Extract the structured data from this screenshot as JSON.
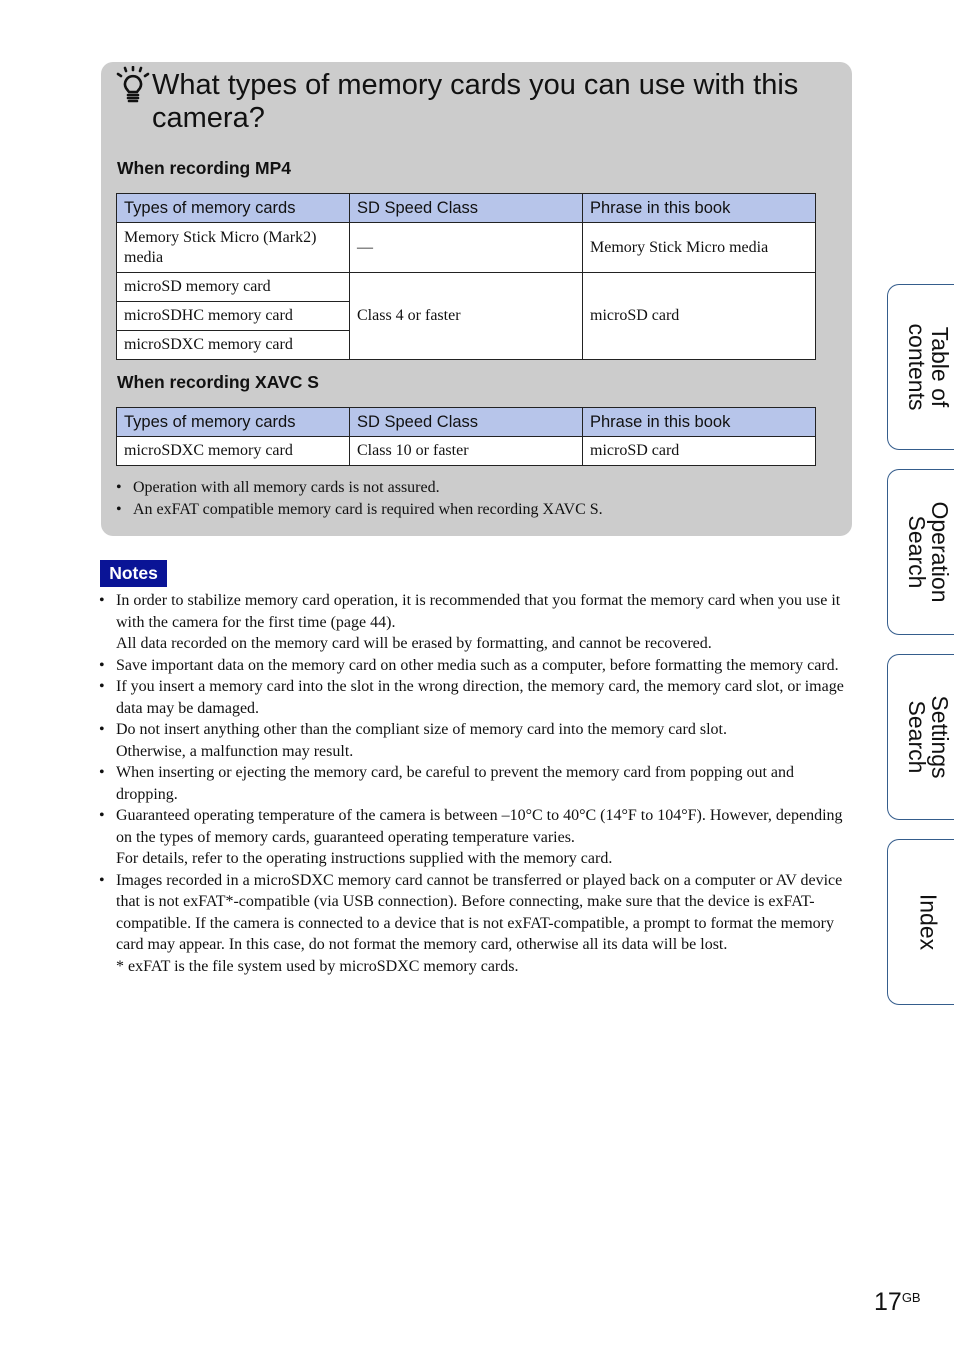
{
  "page": {
    "title": "What types of memory cards you can use with this camera?",
    "title_icon": "hint-lightbulb-icon"
  },
  "mp4_section": {
    "heading": "When recording MP4",
    "columns": [
      "Types of memory cards",
      "SD Speed Class",
      "Phrase in this book"
    ],
    "rows": [
      {
        "type": "Memory Stick Micro (Mark2) media",
        "speed": "—",
        "phrase": "Memory Stick Micro media"
      },
      {
        "type": "microSD memory card",
        "speed": "Class 4 or faster",
        "phrase": "microSD card"
      },
      {
        "type": "microSDHC memory card"
      },
      {
        "type": "microSDXC memory card"
      }
    ]
  },
  "xavc_section": {
    "heading": "When recording XAVC S",
    "columns": [
      "Types of memory cards",
      "SD Speed Class",
      "Phrase in this book"
    ],
    "rows": [
      {
        "type": "microSDXC memory card",
        "speed": "Class 10 or faster",
        "phrase": "microSD card"
      }
    ]
  },
  "panel_bullets": [
    "Operation with all memory cards is not assured.",
    "An exFAT compatible memory card is required when recording XAVC S."
  ],
  "notes": {
    "badge": "Notes",
    "items": [
      {
        "text": "In order to stabilize memory card operation, it is recommended that you format the memory card when you use it with the camera for the first time (page 44).",
        "sub": "All data recorded on the memory card will be erased by formatting, and cannot be recovered."
      },
      {
        "text": "Save important data on the memory card on other media such as a computer, before formatting the memory card."
      },
      {
        "text": "If you insert a memory card into the slot in the wrong direction, the memory card, the memory card slot, or image data may be damaged."
      },
      {
        "text": "Do not insert anything other than the compliant size of memory card into the memory card slot.",
        "sub": "Otherwise, a malfunction may result."
      },
      {
        "text": "When inserting or ejecting the memory card, be careful to prevent the memory card from popping out and dropping."
      },
      {
        "text": "Guaranteed operating temperature of the camera is between –10°C to 40°C (14°F to 104°F). However, depending on the types of memory cards, guaranteed operating temperature varies.",
        "sub": "For details, refer to the operating instructions supplied with the memory card."
      },
      {
        "text": "Images recorded in a microSDXC memory card cannot be transferred or played back on a computer or AV device that is not exFAT*-compatible (via USB connection). Before connecting, make sure that the device is exFAT-compatible. If the camera is connected to a device that is not exFAT-compatible, a prompt to format the memory card may appear. In this case, do not format the memory card, otherwise all its data will be lost."
      }
    ],
    "footnote": "*  exFAT is the file system used by microSDXC memory cards."
  },
  "side_tabs": [
    {
      "label": "Table of\ncontents"
    },
    {
      "label": "Operation\nSearch"
    },
    {
      "label": "Settings\nSearch"
    },
    {
      "label": "Index"
    }
  ],
  "footer": {
    "page_number": "17",
    "page_suffix": "GB"
  },
  "colors": {
    "panel_bg": "#cccccc",
    "table_header_bg": "#b7c5ea",
    "notes_badge_bg": "#0a1496",
    "tab_border": "#355d8c"
  }
}
